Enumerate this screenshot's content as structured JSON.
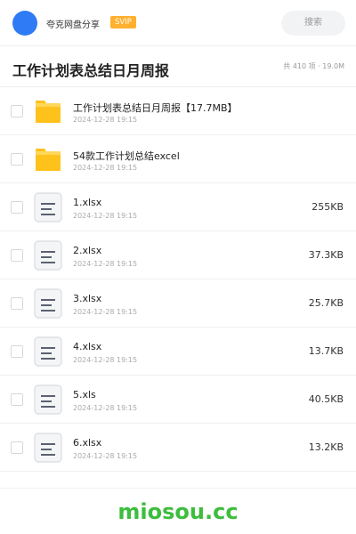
{
  "topbar": {
    "username": "夸克网盘分享",
    "badge": "SVIP",
    "search_label": "搜索"
  },
  "header": {
    "title": "工作计划表总结日月周报",
    "stats": "共 410 项 · 19.0M"
  },
  "files": [
    {
      "name": "工作计划表总结日月周报【17.7MB】",
      "date": "2024-12-28 19:15",
      "size": "",
      "icon": "folder-icon"
    },
    {
      "name": "54款工作计划总结excel",
      "date": "2024-12-28 19:15",
      "size": "",
      "icon": "folder-icon"
    },
    {
      "name": "1.xlsx",
      "date": "2024-12-28 19:15",
      "size": "255KB",
      "icon": "document-icon"
    },
    {
      "name": "2.xlsx",
      "date": "2024-12-28 19:15",
      "size": "37.3KB",
      "icon": "document-icon"
    },
    {
      "name": "3.xlsx",
      "date": "2024-12-28 19:15",
      "size": "25.7KB",
      "icon": "document-icon"
    },
    {
      "name": "4.xlsx",
      "date": "2024-12-28 19:15",
      "size": "13.7KB",
      "icon": "document-icon"
    },
    {
      "name": "5.xls",
      "date": "2024-12-28 19:15",
      "size": "40.5KB",
      "icon": "document-icon"
    },
    {
      "name": "6.xlsx",
      "date": "2024-12-28 19:15",
      "size": "13.2KB",
      "icon": "document-icon"
    }
  ],
  "footer": {
    "watermark": "miosou.cc"
  },
  "colors": {
    "avatar": "#2f7bf5",
    "badge": "#ffb02e",
    "folder": "#ffc21c",
    "watermark": "#3dbd3d"
  }
}
